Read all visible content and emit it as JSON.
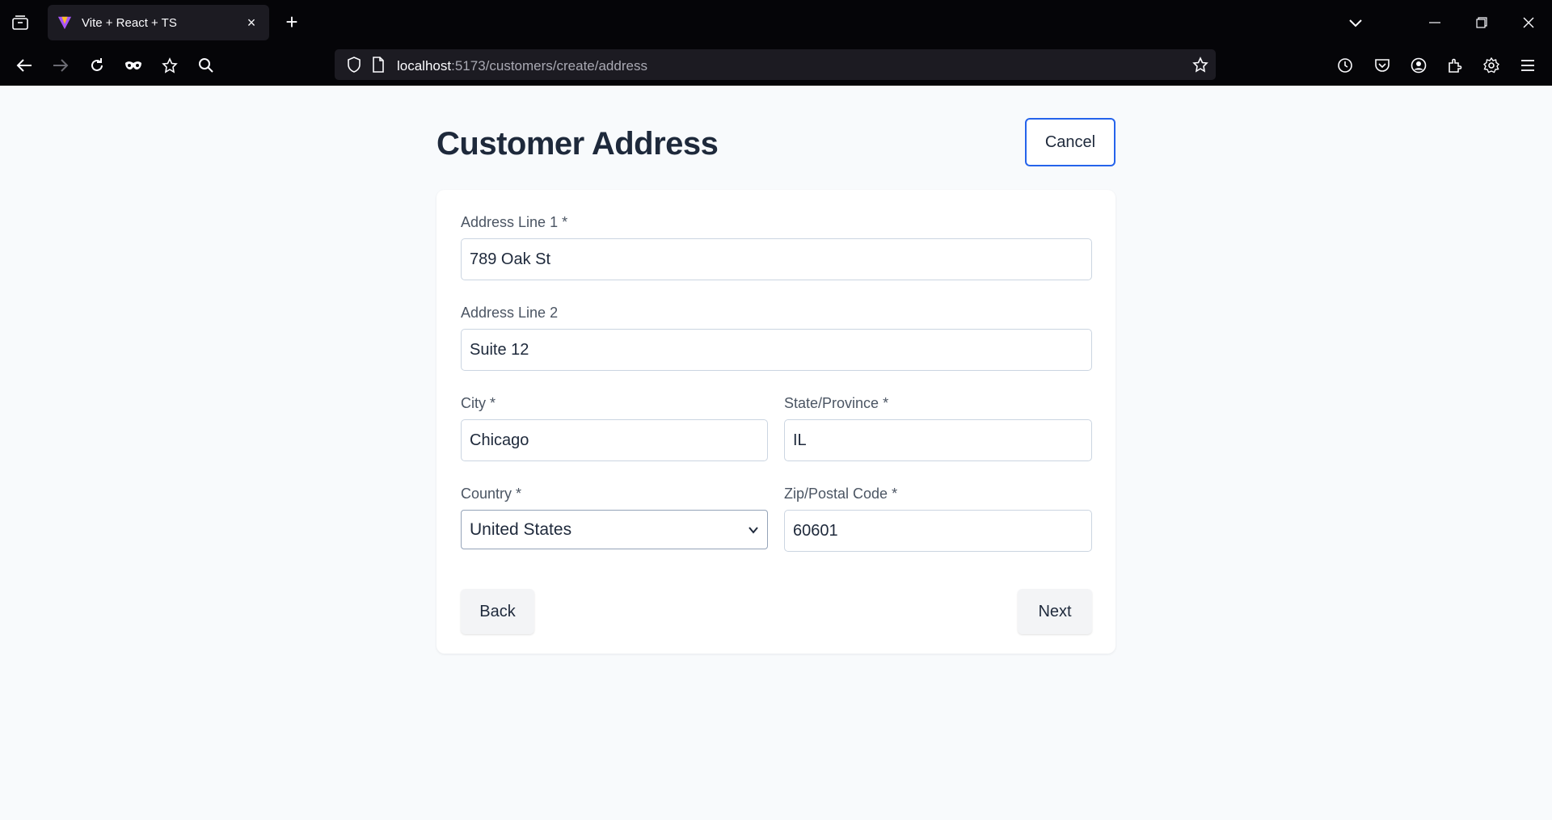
{
  "browser": {
    "tab_title": "Vite + React + TS",
    "tab_close": "×",
    "new_tab": "+",
    "url_host": "localhost",
    "url_path": ":5173/customers/create/address"
  },
  "page": {
    "title": "Customer Address",
    "cancel_label": "Cancel"
  },
  "form": {
    "address1": {
      "label": "Address Line 1 *",
      "value": "789 Oak St"
    },
    "address2": {
      "label": "Address Line 2",
      "value": "Suite 12"
    },
    "city": {
      "label": "City *",
      "value": "Chicago"
    },
    "state": {
      "label": "State/Province *",
      "value": "IL"
    },
    "country": {
      "label": "Country *",
      "value": "United States"
    },
    "zip": {
      "label": "Zip/Postal Code *",
      "value": "60601"
    },
    "back_label": "Back",
    "next_label": "Next"
  },
  "colors": {
    "accent": "#2563eb",
    "chrome_bg": "#050508",
    "title_text": "#1e293b"
  }
}
